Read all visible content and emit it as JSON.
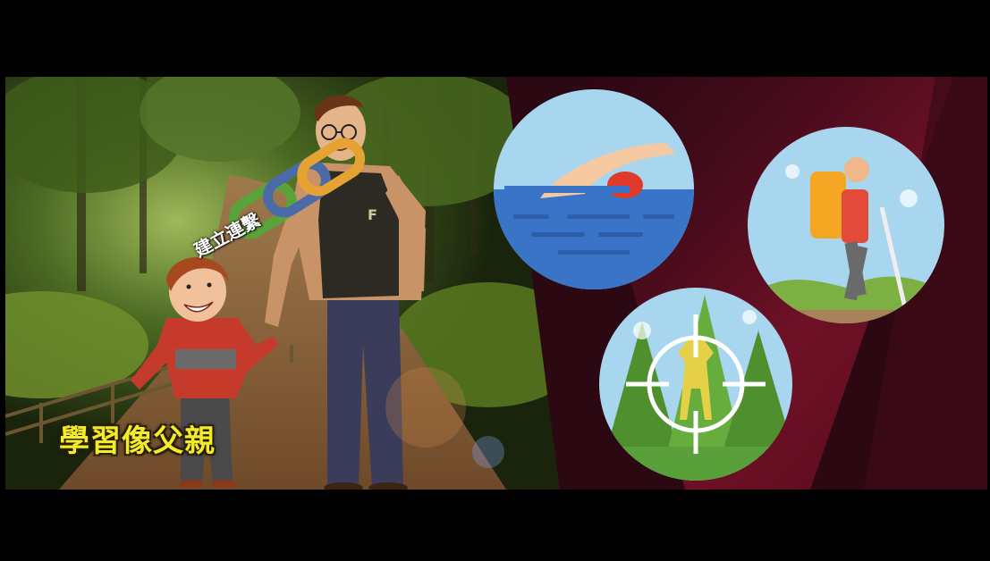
{
  "captions": {
    "main": "學習像父親",
    "link": "建立連繫"
  },
  "icons": {
    "swimming": "swimmer-icon",
    "hiking": "hiker-icon",
    "hunting": "deer-target-icon",
    "chain": "chain-link-icon"
  },
  "colors": {
    "caption_yellow": "#f3ec2a",
    "sky_blue": "#a9d6ef",
    "water_blue": "#3a74c6",
    "forest_green": "#5aa03a"
  }
}
